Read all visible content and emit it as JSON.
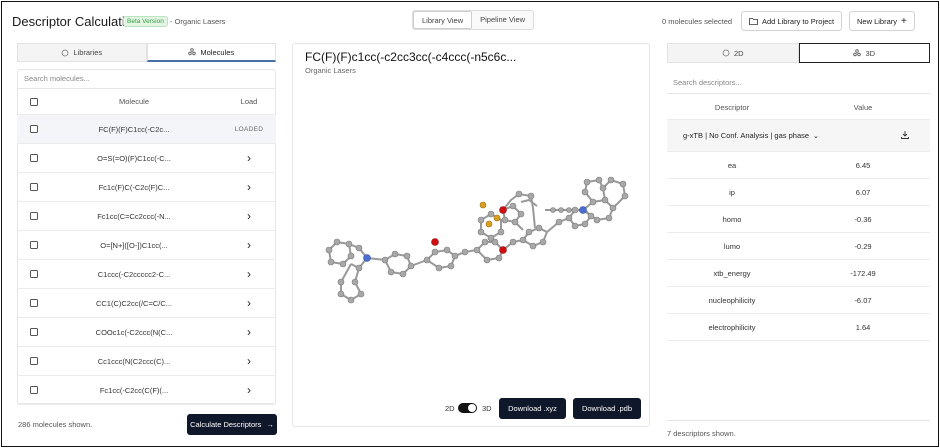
{
  "header": {
    "app_title": "Descriptor Calculation",
    "beta_badge": "Beta Version",
    "subtitle": "- Organic Lasers",
    "view_tabs": [
      "Library View",
      "Pipeline View"
    ],
    "molecules_selected": "0 molecules selected",
    "add_library_label": "Add Library to Project",
    "new_library_label": "New Library"
  },
  "left_panel": {
    "tabs": [
      "Libraries",
      "Molecules"
    ],
    "active_tab": "Molecules",
    "search_placeholder": "Search molecules...",
    "columns": [
      "Molecule",
      "Load"
    ],
    "rows": [
      {
        "smiles": "FC(F)(F)C1cc(-C2c...",
        "load": "LOADED"
      },
      {
        "smiles": "O=S(=O)(F)C1cc(-C...",
        "load": ""
      },
      {
        "smiles": "Fc1c(F)C(-C2c(F)C...",
        "load": ""
      },
      {
        "smiles": "Fc1cc(C=Cc2ccc(-N...",
        "load": ""
      },
      {
        "smiles": "O=[N+]([O-])C1cc(...",
        "load": ""
      },
      {
        "smiles": "C1ccc(-C2ccccc2-C...",
        "load": ""
      },
      {
        "smiles": "CC1(C)C2cc(/C=C/C...",
        "load": ""
      },
      {
        "smiles": "COOc1c(-C2ccc(N(C...",
        "load": ""
      },
      {
        "smiles": "Cc1ccc(N(C2ccc(C)...",
        "load": ""
      },
      {
        "smiles": "Fc1cc(-C2cc(C(F)(...",
        "load": ""
      }
    ],
    "count_text": "286 molecules shown.",
    "calculate_label": "Calculate Descriptors"
  },
  "center_panel": {
    "molecule_title": "FC(F)(F)c1cc(-c2cc3cc(-c4ccc(-n5c6c...",
    "library_name": "Organic Lasers",
    "toggle_2d": "2D",
    "toggle_3d": "3D",
    "download_xyz_label": "Download .xyz",
    "download_pdb_label": "Download .pdb"
  },
  "right_panel": {
    "tabs": [
      "2D",
      "3D"
    ],
    "active_tab": "3D",
    "search_placeholder": "Search descriptors...",
    "columns": [
      "Descriptor",
      "Value"
    ],
    "method_select": "g-xTB | No Conf. Analysis | gas phase",
    "rows": [
      {
        "name": "ea",
        "value": "6.45"
      },
      {
        "name": "ip",
        "value": "6.07"
      },
      {
        "name": "homo",
        "value": "-0.36"
      },
      {
        "name": "lumo",
        "value": "-0.29"
      },
      {
        "name": "xtb_energy",
        "value": "-172.49"
      },
      {
        "name": "nucleophilicity",
        "value": "-6.07"
      },
      {
        "name": "electrophilicity",
        "value": "1.64"
      }
    ],
    "count_text": "7 descriptors shown."
  }
}
